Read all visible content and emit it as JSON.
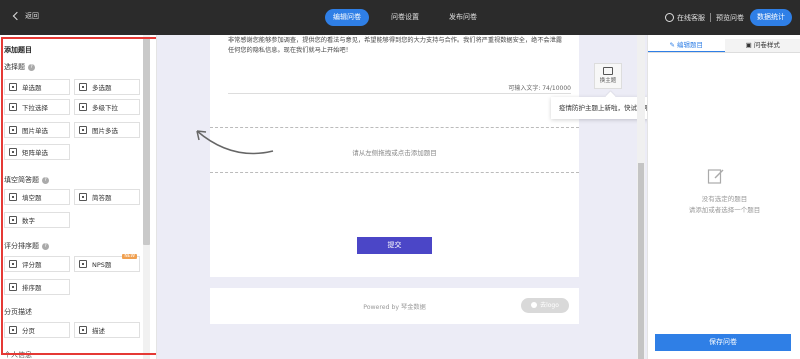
{
  "topbar": {
    "back_label": "返回",
    "tabs": [
      {
        "label": "编辑问卷",
        "active": true
      },
      {
        "label": "问卷设置",
        "active": false
      },
      {
        "label": "发布问卷",
        "active": false
      }
    ],
    "online_service": "在线客服",
    "preview": "预览问卷",
    "stats": "数据统计"
  },
  "left": {
    "title": "添加题目",
    "groups": [
      {
        "title": "选择题",
        "items": [
          "单选题",
          "多选题",
          "下拉选择",
          "多级下拉",
          "图片单选",
          "图片多选",
          "矩阵单选"
        ]
      },
      {
        "title": "填空简答题",
        "items": [
          "填空题",
          "简答题",
          "数字"
        ]
      },
      {
        "title": "评分排序题",
        "items": [
          "评分题",
          "NPS题",
          "排序题"
        ],
        "badge": "NEW"
      },
      {
        "title": "分页描述",
        "items": [
          "分页",
          "描述"
        ]
      }
    ],
    "next_group_partial": "个人信息"
  },
  "canvas": {
    "intro_text": "非常感谢您能够参加调查，提供您的看法与意见，希望能够得到您的大力支持与合作。我们将严重视数据安全，绝不会泄露任何您的隐私信息。现在我们就马上开始吧！",
    "counter": "可输入文字: 74/10000",
    "dropzone_text": "请从左侧拖拽或点击添加题目",
    "submit_label": "提交",
    "powered_by": "Powered by 琴金数据",
    "remove_logo": "去logo",
    "theme_button": "换主题",
    "tooltip": "疫情防护主题上新啦，快试试吧~"
  },
  "right": {
    "tabs": [
      {
        "label": "编辑题目",
        "active": true
      },
      {
        "label": "问卷样式",
        "active": false
      }
    ],
    "empty_line1": "没有选定的题目",
    "empty_line2": "请添加或者选择一个题目",
    "save_label": "保存问卷"
  },
  "colors": {
    "topbar_bg": "#2b2b2b",
    "accent_blue": "#2f7fe6",
    "submit_purple": "#4b46c7",
    "highlight_red": "#e53935",
    "canvas_bg": "#ececf6"
  }
}
